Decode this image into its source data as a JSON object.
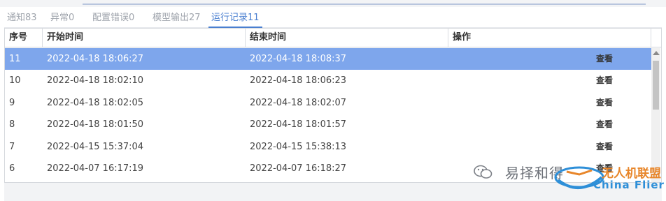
{
  "tabs": [
    {
      "label": "通知83"
    },
    {
      "label": "异常0"
    },
    {
      "label": "配置错误0"
    },
    {
      "label": "模型输出27"
    },
    {
      "label": "运行记录11"
    }
  ],
  "table": {
    "columns": [
      "序号",
      "开始时间",
      "结束时间",
      "操作"
    ],
    "rows": [
      {
        "no": "11",
        "start": "2022-04-18 18:06:27",
        "end": "2022-04-18 18:08:37",
        "action": "查看"
      },
      {
        "no": "10",
        "start": "2022-04-18 18:02:10",
        "end": "2022-04-18 18:06:23",
        "action": "查看"
      },
      {
        "no": "9",
        "start": "2022-04-18 18:02:05",
        "end": "2022-04-18 18:02:07",
        "action": "查看"
      },
      {
        "no": "8",
        "start": "2022-04-18 18:01:50",
        "end": "2022-04-18 18:01:57",
        "action": "查看"
      },
      {
        "no": "7",
        "start": "2022-04-15 15:37:04",
        "end": "2022-04-15 15:38:13",
        "action": "查看"
      },
      {
        "no": "6",
        "start": "2022-04-07 16:17:19",
        "end": "2022-04-07 16:18:27",
        "action": "查看"
      }
    ]
  },
  "watermark": {
    "account": "易择和得",
    "brand_cn": "无人机联盟",
    "brand_en": "China Flier"
  },
  "colors": {
    "accent": "#4a7fd0",
    "selected_row": "#7ea6ec"
  },
  "icons": {
    "wechat": "wechat-icon",
    "scroll_up": "chevron-up-icon"
  }
}
